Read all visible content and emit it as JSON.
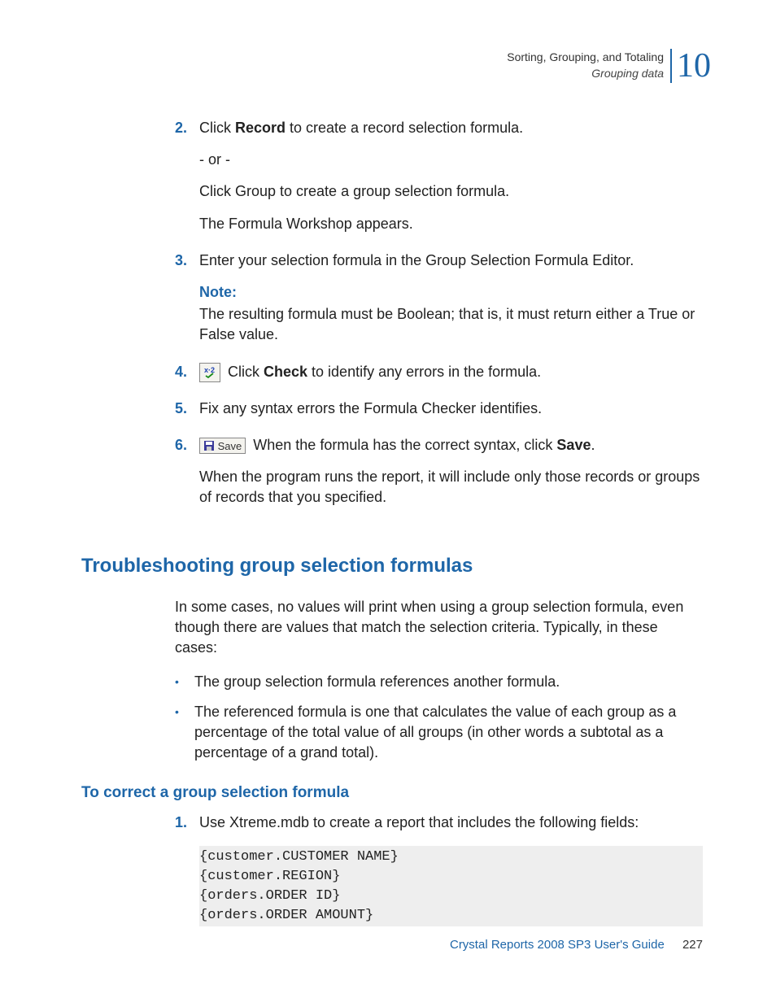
{
  "header": {
    "chapter_title": "Sorting, Grouping, and Totaling",
    "section_title": "Grouping data",
    "chapter_number": "10"
  },
  "steps": {
    "s2": {
      "num": "2.",
      "line1_pre": "Click ",
      "line1_bold": "Record",
      "line1_post": " to create a record selection formula.",
      "or": "- or -",
      "line2": "Click Group to create a group selection formula.",
      "line3": "The Formula Workshop appears."
    },
    "s3": {
      "num": "3.",
      "line1": "Enter your selection formula in the Group Selection Formula Editor.",
      "note_label": "Note:",
      "note_text": "The resulting formula must be Boolean; that is, it must return either a True or False value."
    },
    "s4": {
      "num": "4.",
      "text_pre": " Click ",
      "text_bold": "Check",
      "text_post": " to identify any errors in the formula."
    },
    "s5": {
      "num": "5.",
      "text": "Fix any syntax errors the Formula Checker identifies."
    },
    "s6": {
      "num": "6.",
      "icon_label": "Save",
      "text_pre": " When the formula has the correct syntax, click ",
      "text_bold": "Save",
      "text_post": ".",
      "after": "When the program runs the report, it will include only those records or groups of records that you specified."
    }
  },
  "h2": "Troubleshooting group selection formulas",
  "troubleshoot_intro": "In some cases, no values will print when using a group selection formula, even though there are values that match the selection criteria. Typically, in these cases:",
  "bullets": {
    "b1": "The group selection formula references another formula.",
    "b2": "The referenced formula is one that calculates the value of each group as a percentage of the total value of all groups (in other words a subtotal as a percentage of a grand total)."
  },
  "h3": "To correct a group selection formula",
  "correct": {
    "s1": {
      "num": "1.",
      "text": "Use Xtreme.mdb to create a report that includes the following fields:"
    }
  },
  "chart_data": {
    "type": "table",
    "fields": [
      "{customer.CUSTOMER NAME}",
      "{customer.REGION}",
      "{orders.ORDER ID}",
      "{orders.ORDER AMOUNT}"
    ]
  },
  "code_text": "{customer.CUSTOMER NAME}\n{customer.REGION}\n{orders.ORDER ID}\n{orders.ORDER AMOUNT}",
  "footer": {
    "title": "Crystal Reports 2008 SP3 User's Guide",
    "page": "227"
  }
}
